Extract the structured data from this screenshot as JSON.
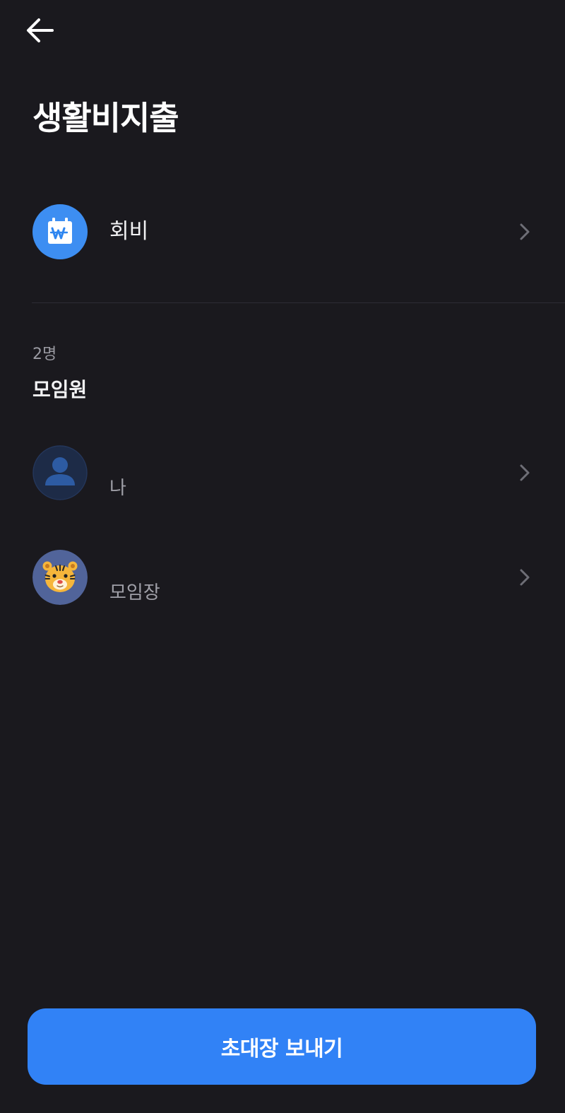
{
  "header": {
    "back_icon": "arrow-left-icon",
    "title": "생활비지출"
  },
  "fee": {
    "icon": "won-calendar-icon",
    "label": "회비"
  },
  "members": {
    "count": "2명",
    "title": "모임원",
    "items": [
      {
        "avatar": "person-icon",
        "label": "나"
      },
      {
        "avatar": "tiger-icon",
        "label": "모임장"
      }
    ]
  },
  "invite_button": {
    "label": "초대장 보내기"
  },
  "colors": {
    "background": "#1a191e",
    "accent": "#3182f6",
    "fee_icon_bg": "#3d8ef2",
    "divider": "#2e2d34"
  }
}
